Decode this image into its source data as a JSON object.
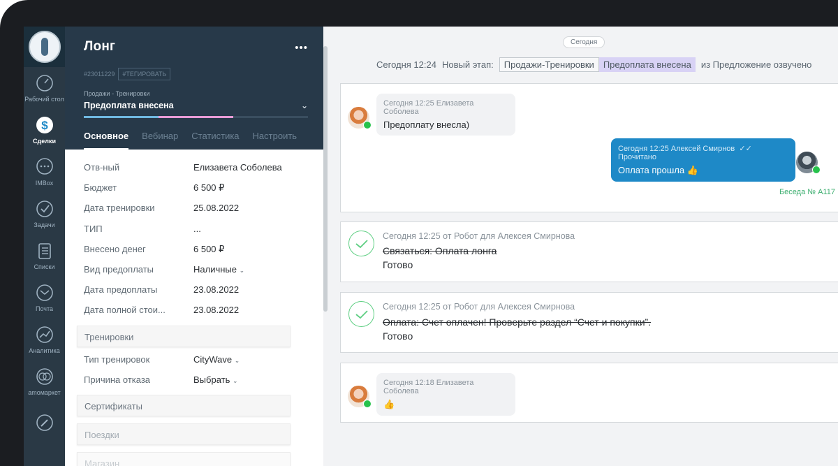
{
  "nav": {
    "items": [
      {
        "label": "Рабочий стол",
        "icon": "dashboard-icon"
      },
      {
        "label": "Сделки",
        "icon": "deals-dollar-icon"
      },
      {
        "label": "IMBox",
        "icon": "chat-bubble-icon"
      },
      {
        "label": "Задачи",
        "icon": "tasks-check-icon"
      },
      {
        "label": "Списки",
        "icon": "lists-icon"
      },
      {
        "label": "Почта",
        "icon": "mail-icon"
      },
      {
        "label": "Аналитика",
        "icon": "analytics-icon"
      },
      {
        "label": "amoмаркет",
        "icon": "market-icon"
      }
    ]
  },
  "deal": {
    "title": "Лонг",
    "more": "•••",
    "id": "#23011229",
    "tag_button": "#ТЕГИРОВАТЬ",
    "pipeline": "Продажи - Тренировки",
    "stage": "Предоплата внесена",
    "tabs": [
      "Основное",
      "Вебинар",
      "Статистика",
      "Настроить"
    ],
    "fields": [
      {
        "label": "Отв-ный",
        "value": "Елизавета Соболева"
      },
      {
        "label": "Бюджет",
        "value": "6 500 ₽"
      },
      {
        "label": "Дата тренировки",
        "value": "25.08.2022"
      },
      {
        "label": "ТИП",
        "value": "..."
      },
      {
        "label": "Внесено денег",
        "value": "6 500 ₽"
      },
      {
        "label": "Вид предоплаты",
        "value": "Наличные"
      },
      {
        "label": "Дата предоплаты",
        "value": "23.08.2022"
      },
      {
        "label": "Дата полной стои...",
        "value": "23.08.2022"
      }
    ],
    "section_trainings": "Тренировки",
    "training_fields": [
      {
        "label": "Тип тренировок",
        "value": "CityWave"
      },
      {
        "label": "Причина отказа",
        "value": "Выбрать"
      }
    ],
    "sections": [
      "Сертификаты",
      "Поездки",
      "Магазин"
    ]
  },
  "feed": {
    "date_pill": "Сегодня",
    "stage_change": {
      "time": "Сегодня 12:24",
      "label": "Новый этап:",
      "from": "Продажи-Тренировки",
      "to": "Предоплата внесена",
      "tail": "из Предложение озвучено"
    },
    "msg_in_1": {
      "meta": "Сегодня 12:25  Елизавета Соболева",
      "text": "Предоплату внесла)"
    },
    "msg_out": {
      "meta": "Сегодня 12:25  Алексей Смирнов",
      "status": "✓✓ Прочитано",
      "text": "Оплата прошла 👍"
    },
    "conversation": "Беседа № А117",
    "robot1": {
      "meta": "Сегодня 12:25 от Робот для Алексея Смирнова",
      "task": "Связаться: Оплата лонга",
      "result": "Готово"
    },
    "robot2": {
      "meta": "Сегодня 12:25 от Робот для Алексея Смирнова",
      "task": "Оплата: Счет оплачен! Проверьте раздел “Счет и покупки”.",
      "result": "Готово"
    },
    "msg_in_2": {
      "meta": "Сегодня 12:18  Елизавета Соболева",
      "text": "👍"
    }
  },
  "colors": {
    "accent": "#1e89c7",
    "nav_bg": "#2a3945",
    "stage_highlight": "#d8d2f5",
    "success": "#5fcf83"
  }
}
